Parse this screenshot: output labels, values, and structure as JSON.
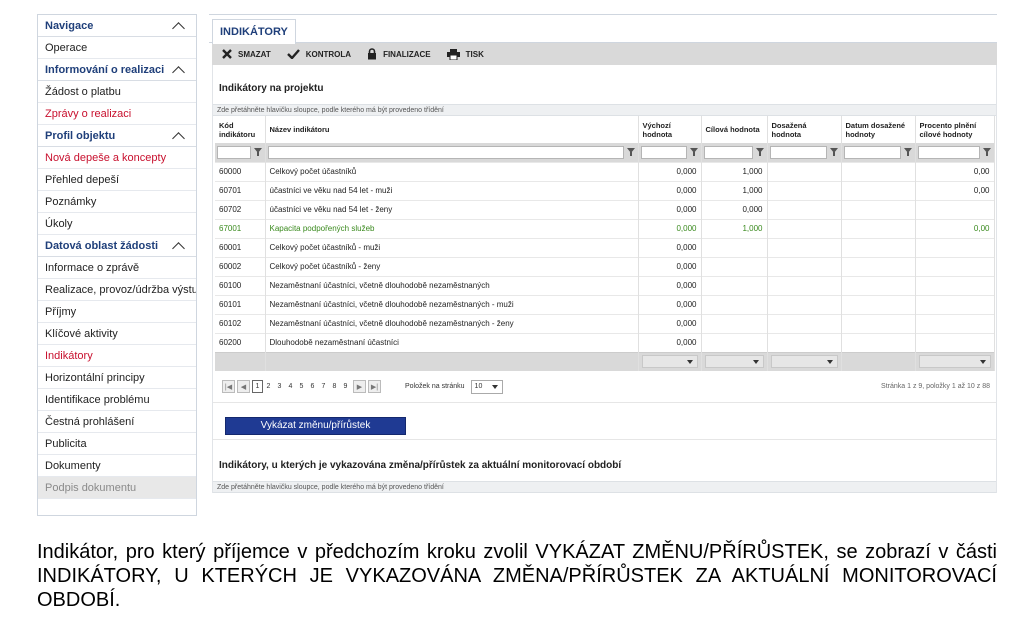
{
  "sidebar": {
    "items": [
      {
        "label": "Navigace",
        "type": "header"
      },
      {
        "label": "Operace",
        "type": "item"
      },
      {
        "label": "Informování o realizaci",
        "type": "header"
      },
      {
        "label": "Žádost o platbu",
        "type": "item"
      },
      {
        "label": "Zprávy o realizaci",
        "type": "red"
      },
      {
        "label": "Profil objektu",
        "type": "header"
      },
      {
        "label": "Nová depeše a koncepty",
        "type": "red"
      },
      {
        "label": "Přehled depeší",
        "type": "item"
      },
      {
        "label": "Poznámky",
        "type": "item"
      },
      {
        "label": "Úkoly",
        "type": "item"
      },
      {
        "label": "Datová oblast žádosti",
        "type": "header"
      },
      {
        "label": "Informace o zprávě",
        "type": "item"
      },
      {
        "label": "Realizace, provoz/údržba výstupu",
        "type": "item"
      },
      {
        "label": "Příjmy",
        "type": "item"
      },
      {
        "label": "Klíčové aktivity",
        "type": "item"
      },
      {
        "label": "Indikátory",
        "type": "red"
      },
      {
        "label": "Horizontální principy",
        "type": "item"
      },
      {
        "label": "Identifikace problému",
        "type": "item"
      },
      {
        "label": "Čestná prohlášení",
        "type": "item"
      },
      {
        "label": "Publicita",
        "type": "item"
      },
      {
        "label": "Dokumenty",
        "type": "item"
      },
      {
        "label": "Podpis dokumentu",
        "type": "disabled"
      }
    ]
  },
  "main": {
    "tab_label": "INDIKÁTORY",
    "toolbar": {
      "delete": "SMAZAT",
      "check": "KONTROLA",
      "finalize": "FINALIZACE",
      "print": "TISK"
    },
    "section_title": "Indikátory na projektu",
    "group_hint": "Zde přetáhněte hlavičku sloupce, podle kterého má být provedeno třídění",
    "columns": [
      "Kód indikátoru",
      "Název indikátoru",
      "Výchozí hodnota",
      "Cílová hodnota",
      "Dosažená hodnota",
      "Datum dosažené hodnoty",
      "Procento plnění cílové hodnoty"
    ],
    "rows": [
      {
        "code": "60000",
        "name": "Celkový počet účastníků",
        "base": "0,000",
        "target": "1,000",
        "achieved": "",
        "date": "",
        "pct": "0,00",
        "green": false
      },
      {
        "code": "60701",
        "name": "účastníci ve věku nad 54 let - muži",
        "base": "0,000",
        "target": "1,000",
        "achieved": "",
        "date": "",
        "pct": "0,00",
        "green": false
      },
      {
        "code": "60702",
        "name": "účastníci ve věku nad 54 let - ženy",
        "base": "0,000",
        "target": "0,000",
        "achieved": "",
        "date": "",
        "pct": "",
        "green": false
      },
      {
        "code": "67001",
        "name": "Kapacita podpořených služeb",
        "base": "0,000",
        "target": "1,000",
        "achieved": "",
        "date": "",
        "pct": "0,00",
        "green": true
      },
      {
        "code": "60001",
        "name": "Celkový počet účastníků - muži",
        "base": "0,000",
        "target": "",
        "achieved": "",
        "date": "",
        "pct": "",
        "green": false
      },
      {
        "code": "60002",
        "name": "Celkový počet účastníků - ženy",
        "base": "0,000",
        "target": "",
        "achieved": "",
        "date": "",
        "pct": "",
        "green": false
      },
      {
        "code": "60100",
        "name": "Nezaměstnaní účastníci, včetně dlouhodobě nezaměstnaných",
        "base": "0,000",
        "target": "",
        "achieved": "",
        "date": "",
        "pct": "",
        "green": false
      },
      {
        "code": "60101",
        "name": "Nezaměstnaní účastníci, včetně dlouhodobě nezaměstnaných - muži",
        "base": "0,000",
        "target": "",
        "achieved": "",
        "date": "",
        "pct": "",
        "green": false
      },
      {
        "code": "60102",
        "name": "Nezaměstnaní účastníci, včetně dlouhodobě nezaměstnaných - ženy",
        "base": "0,000",
        "target": "",
        "achieved": "",
        "date": "",
        "pct": "",
        "green": false
      },
      {
        "code": "60200",
        "name": "Dlouhodobě nezaměstnaní účastníci",
        "base": "0,000",
        "target": "",
        "achieved": "",
        "date": "",
        "pct": "",
        "green": false
      }
    ],
    "pager": {
      "pages": [
        "1",
        "2",
        "3",
        "4",
        "5",
        "6",
        "7",
        "8",
        "9"
      ],
      "active_page": "1",
      "per_page_label": "Položek na stránku",
      "per_page_value": "10",
      "info": "Stránka 1 z 9, položky 1 až 10 z 88"
    },
    "action_button": "Vykázat změnu/přírůstek",
    "section2_title": "Indikátory, u kterých je vykazována změna/přírůstek za aktuální monitorovací období",
    "section2_hint": "Zde přetáhněte hlavičku sloupce, podle kterého má být provedeno třídění"
  },
  "caption": "Indikátor, pro který příjemce v předchozím kroku zvolil VYKÁZAT ZMĚNU/PŘÍRŮSTEK, se zobrazí v části INDIKÁTORY, U KTERÝCH JE VYKAZOVÁNA ZMĚNA/PŘÍRŮSTEK ZA AKTUÁLNÍ MONITOROVACÍ OBDOBÍ.",
  "colors": {
    "accent_blue": "#1f3f7a",
    "button_blue": "#1f3a93",
    "red_link": "#c8102e",
    "green_row": "#3a8a1e",
    "toolbar_grey": "#d9d9d9"
  },
  "icons": [
    "chevron-up-icon",
    "close-icon",
    "checkmark-icon",
    "lock-icon",
    "printer-icon",
    "filter-icon",
    "dropdown-arrow-icon",
    "first-page-icon",
    "prev-page-icon",
    "next-page-icon",
    "last-page-icon"
  ]
}
